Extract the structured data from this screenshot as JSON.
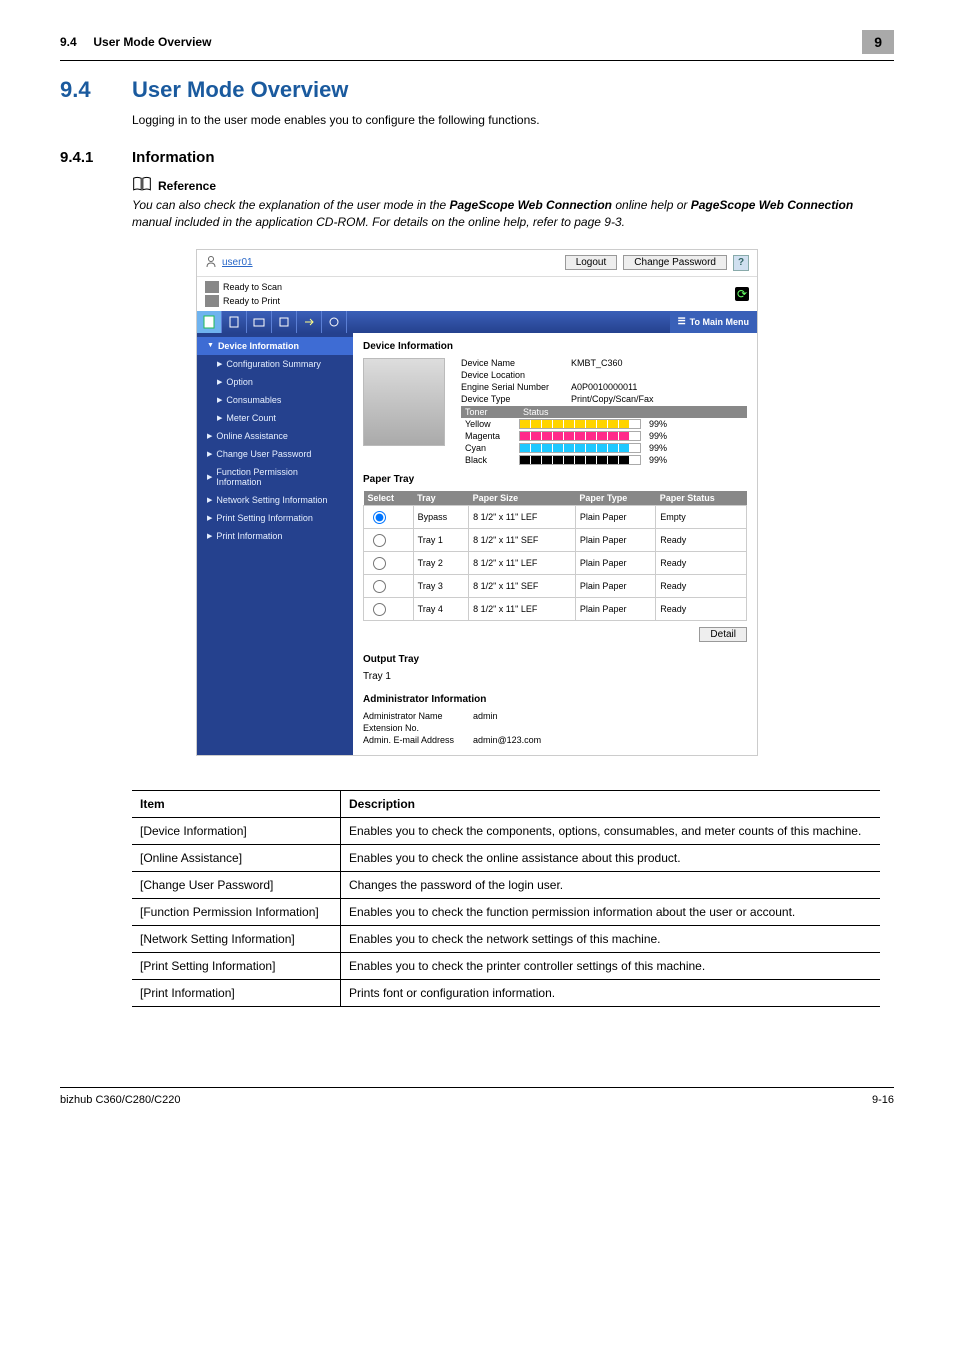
{
  "header": {
    "section_num": "9.4",
    "section_title": "User Mode Overview",
    "badge": "9"
  },
  "h1": {
    "num": "9.4",
    "title": "User Mode Overview"
  },
  "intro": "Logging in to the user mode enables you to configure the following functions.",
  "h2": {
    "num": "9.4.1",
    "title": "Information"
  },
  "reference": {
    "heading": "Reference",
    "text_before": "You can also check the explanation of the user mode in the ",
    "em1": "PageScope Web Connection",
    "text_mid1": " online help or ",
    "em2": "PageScope Web Connection",
    "text_mid2": " manual included in the application CD-ROM. For details on the online help, refer to page 9-3."
  },
  "screenshot": {
    "user": "user01",
    "logout": "Logout",
    "change_pw": "Change Password",
    "help": "?",
    "status1": "Ready to Scan",
    "status2": "Ready to Print",
    "to_main": "To Main Menu",
    "side": {
      "header": "Device Information",
      "items": [
        "Configuration Summary",
        "Option",
        "Consumables",
        "Meter Count",
        "Online Assistance",
        "Change User Password",
        "Function Permission Information",
        "Network Setting Information",
        "Print Setting Information",
        "Print Information"
      ]
    },
    "content": {
      "title": "Device Information",
      "device_name_k": "Device Name",
      "device_name_v": "KMBT_C360",
      "device_loc_k": "Device Location",
      "serial_k": "Engine Serial Number",
      "serial_v": "A0P0010000011",
      "devtype_k": "Device Type",
      "devtype_v": "Print/Copy/Scan/Fax",
      "toner_h1": "Toner",
      "toner_h2": "Status",
      "toner": [
        {
          "name": "Yellow",
          "pct": "99%"
        },
        {
          "name": "Magenta",
          "pct": "99%"
        },
        {
          "name": "Cyan",
          "pct": "99%"
        },
        {
          "name": "Black",
          "pct": "99%"
        }
      ],
      "paper_title": "Paper Tray",
      "paper_headers": {
        "select": "Select",
        "tray": "Tray",
        "size": "Paper Size",
        "type": "Paper Type",
        "status": "Paper Status"
      },
      "paper_rows": [
        {
          "tray": "Bypass",
          "size": "8 1/2\" x 11\" LEF",
          "type": "Plain Paper",
          "status": "Empty"
        },
        {
          "tray": "Tray 1",
          "size": "8 1/2\" x 11\" SEF",
          "type": "Plain Paper",
          "status": "Ready"
        },
        {
          "tray": "Tray 2",
          "size": "8 1/2\" x 11\" LEF",
          "type": "Plain Paper",
          "status": "Ready"
        },
        {
          "tray": "Tray 3",
          "size": "8 1/2\" x 11\" SEF",
          "type": "Plain Paper",
          "status": "Ready"
        },
        {
          "tray": "Tray 4",
          "size": "8 1/2\" x 11\" LEF",
          "type": "Plain Paper",
          "status": "Ready"
        }
      ],
      "detail_btn": "Detail",
      "output_title": "Output Tray",
      "output_val": "Tray 1",
      "admin_title": "Administrator Information",
      "admin_name_k": "Administrator Name",
      "admin_name_v": "admin",
      "admin_ext_k": "Extension No.",
      "admin_email_k": "Admin. E-mail Address",
      "admin_email_v": "admin@123.com"
    }
  },
  "table": {
    "h1": "Item",
    "h2": "Description",
    "rows": [
      {
        "item": "[Device Information]",
        "desc": "Enables you to check the components, options, consumables, and meter counts of this machine."
      },
      {
        "item": "[Online Assistance]",
        "desc": "Enables you to check the online assistance about this product."
      },
      {
        "item": "[Change User Password]",
        "desc": "Changes the password of the login user."
      },
      {
        "item": "[Function Permission Information]",
        "desc": "Enables you to check the function permission information about the user or account."
      },
      {
        "item": "[Network Setting Information]",
        "desc": "Enables you to check the network settings of this machine."
      },
      {
        "item": "[Print Setting Information]",
        "desc": "Enables you to check the printer controller settings of this machine."
      },
      {
        "item": "[Print Information]",
        "desc": "Prints font or configuration information."
      }
    ]
  },
  "footer": {
    "left": "bizhub C360/C280/C220",
    "right": "9-16"
  }
}
